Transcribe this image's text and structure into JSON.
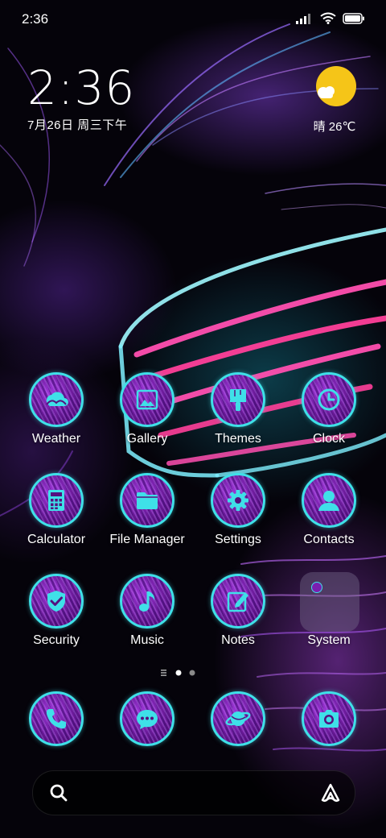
{
  "status_bar": {
    "time": "2:36",
    "icons": [
      "signal-icon",
      "wifi-icon",
      "battery-icon"
    ]
  },
  "clock_widget": {
    "time": "2:36",
    "date": "7月26日 周三下午"
  },
  "weather_widget": {
    "icon": "sun-cloud-icon",
    "condition": "晴",
    "temperature": "26℃",
    "label": "晴 26℃"
  },
  "apps": [
    {
      "label": "Weather",
      "icon": "weather-icon"
    },
    {
      "label": "Gallery",
      "icon": "gallery-icon"
    },
    {
      "label": "Themes",
      "icon": "paintbrush-icon"
    },
    {
      "label": "Clock",
      "icon": "clock-icon"
    },
    {
      "label": "Calculator",
      "icon": "calculator-icon"
    },
    {
      "label": "File Manager",
      "icon": "folder-icon"
    },
    {
      "label": "Settings",
      "icon": "gear-icon"
    },
    {
      "label": "Contacts",
      "icon": "person-icon"
    },
    {
      "label": "Security",
      "icon": "shield-check-icon"
    },
    {
      "label": "Music",
      "icon": "music-note-icon"
    },
    {
      "label": "Notes",
      "icon": "note-pencil-icon"
    },
    {
      "label": "System",
      "icon": "folder-group-icon"
    }
  ],
  "page_indicator": {
    "pages": 2,
    "current": 1
  },
  "dock": [
    {
      "name": "Phone",
      "icon": "phone-icon"
    },
    {
      "name": "Messages",
      "icon": "chat-bubble-icon"
    },
    {
      "name": "Browser",
      "icon": "planet-icon"
    },
    {
      "name": "Camera",
      "icon": "camera-icon"
    }
  ],
  "search_bar": {
    "left_icon": "search-icon",
    "right_icon": "assistant-icon"
  },
  "colors": {
    "icon_ring": "#3fe0e8",
    "icon_fill": "#7a1fb0",
    "sun": "#f5c518",
    "background": "#05030a"
  }
}
